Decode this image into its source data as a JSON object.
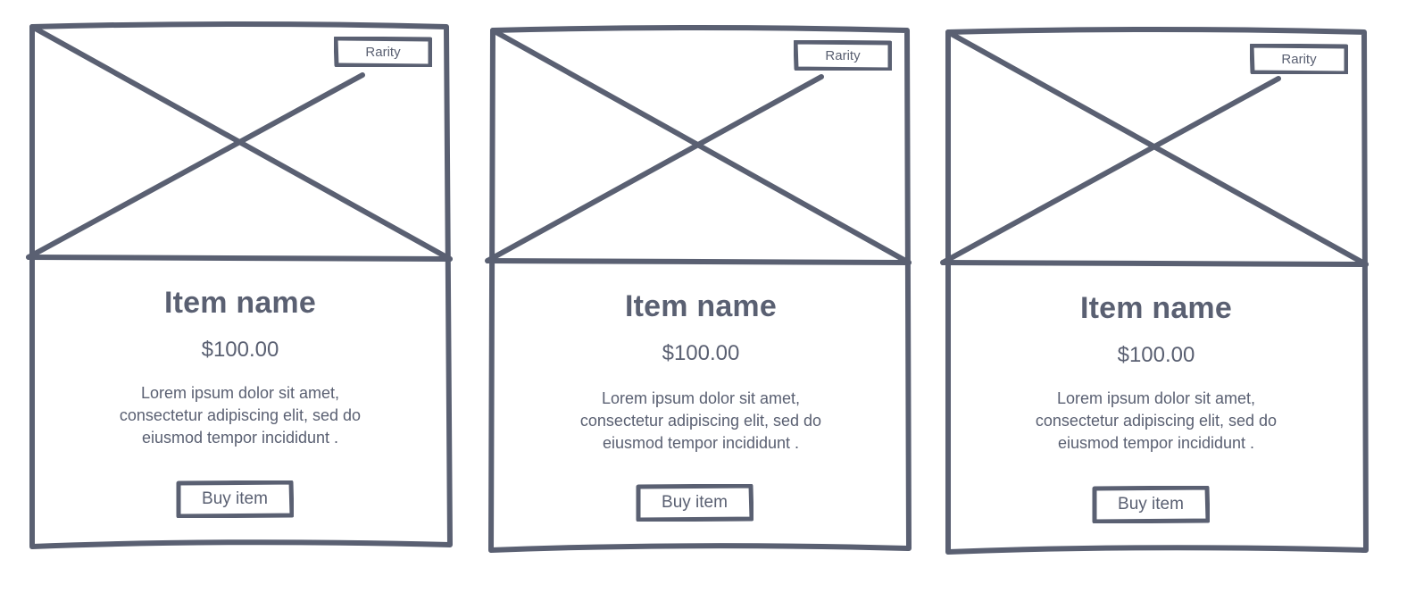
{
  "colors": {
    "stroke": "#5a6072",
    "background": "#ffffff"
  },
  "cards": [
    {
      "rarity": "Rarity",
      "name": "Item name",
      "price": "$100.00",
      "description": "Lorem ipsum dolor sit amet, consectetur adipiscing elit, sed do eiusmod tempor incididunt .",
      "button": "Buy item",
      "image": "image-placeholder-icon"
    },
    {
      "rarity": "Rarity",
      "name": "Item name",
      "price": "$100.00",
      "description": "Lorem ipsum dolor sit amet, consectetur adipiscing elit, sed do eiusmod tempor incididunt .",
      "button": "Buy item",
      "image": "image-placeholder-icon"
    },
    {
      "rarity": "Rarity",
      "name": "Item name",
      "price": "$100.00",
      "description": "Lorem ipsum dolor sit amet, consectetur adipiscing elit, sed do eiusmod tempor incididunt .",
      "button": "Buy item",
      "image": "image-placeholder-icon"
    }
  ]
}
